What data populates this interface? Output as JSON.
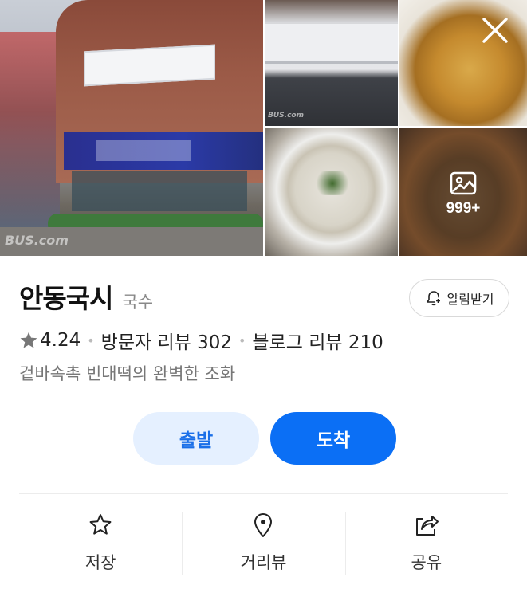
{
  "gallery": {
    "watermark": "BUS.com",
    "more_count": "999+"
  },
  "place": {
    "name": "안동국시",
    "category": "국수",
    "alarm_label": "알림받기",
    "rating": "4.24",
    "visitor_reviews": "방문자 리뷰 302",
    "blog_reviews": "블로그 리뷰 210",
    "description": "겉바속촉 빈대떡의 완벽한 조화"
  },
  "route": {
    "depart_label": "출발",
    "arrive_label": "도착"
  },
  "actions": {
    "save_label": "저장",
    "roadview_label": "거리뷰",
    "share_label": "공유"
  },
  "colors": {
    "accent": "#0b6ff5",
    "accent_light": "#e5f0ff",
    "text_primary": "#111111",
    "text_secondary": "#777777"
  },
  "icons": {
    "close": "close-icon",
    "image": "image-icon",
    "bell": "bell-plus-icon",
    "star": "star-icon",
    "location_pin": "location-pin-icon",
    "share": "share-icon"
  }
}
